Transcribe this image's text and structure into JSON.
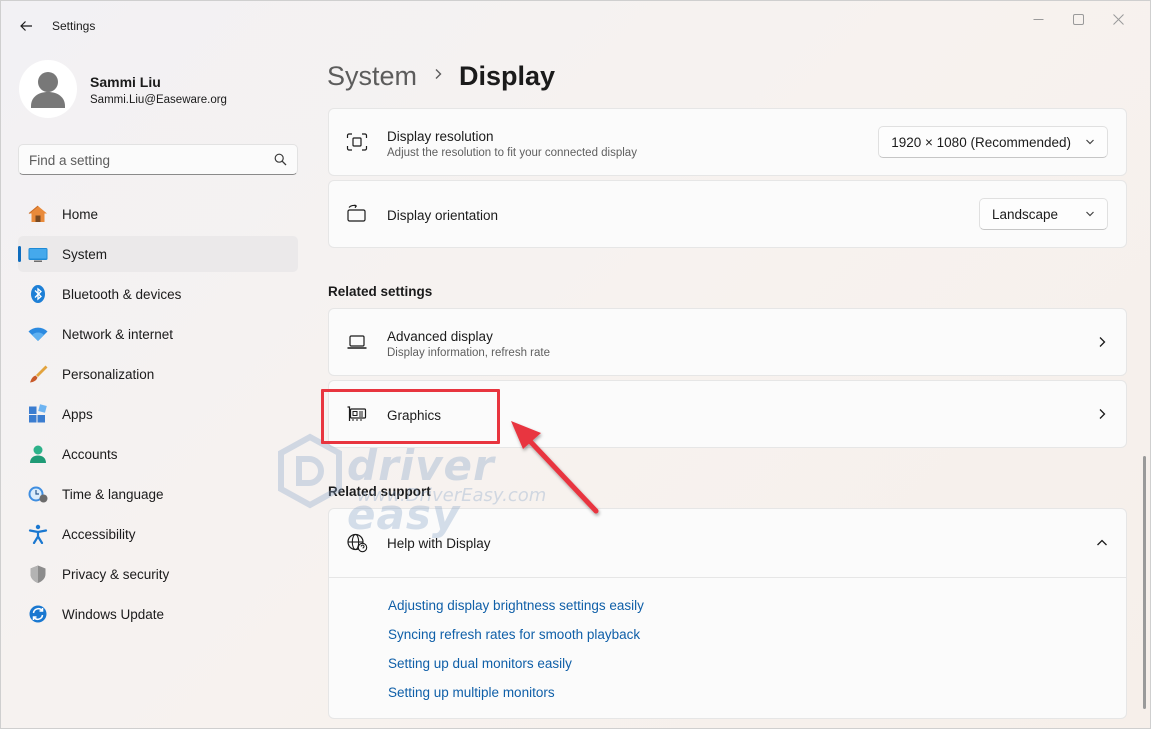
{
  "app": {
    "title": "Settings"
  },
  "profile": {
    "name": "Sammi Liu",
    "email": "Sammi.Liu@Easeware.org"
  },
  "search": {
    "placeholder": "Find a setting"
  },
  "nav": {
    "items": [
      {
        "label": "Home",
        "icon": "home-icon"
      },
      {
        "label": "System",
        "icon": "system-icon",
        "active": true
      },
      {
        "label": "Bluetooth & devices",
        "icon": "bluetooth-icon"
      },
      {
        "label": "Network & internet",
        "icon": "wifi-icon"
      },
      {
        "label": "Personalization",
        "icon": "brush-icon"
      },
      {
        "label": "Apps",
        "icon": "apps-icon"
      },
      {
        "label": "Accounts",
        "icon": "accounts-icon"
      },
      {
        "label": "Time & language",
        "icon": "time-language-icon"
      },
      {
        "label": "Accessibility",
        "icon": "accessibility-icon"
      },
      {
        "label": "Privacy & security",
        "icon": "shield-icon"
      },
      {
        "label": "Windows Update",
        "icon": "windows-update-icon"
      }
    ]
  },
  "breadcrumb": {
    "parent": "System",
    "current": "Display"
  },
  "display_settings": {
    "resolution": {
      "title": "Display resolution",
      "subtitle": "Adjust the resolution to fit your connected display",
      "value": "1920 × 1080 (Recommended)"
    },
    "orientation": {
      "title": "Display orientation",
      "value": "Landscape"
    }
  },
  "related_settings": {
    "heading": "Related settings",
    "advanced": {
      "title": "Advanced display",
      "subtitle": "Display information, refresh rate"
    },
    "graphics": {
      "title": "Graphics"
    }
  },
  "related_support": {
    "heading": "Related support",
    "help": {
      "title": "Help with Display",
      "links": [
        "Adjusting display brightness settings easily",
        "Syncing refresh rates for smooth playback",
        "Setting up dual monitors easily",
        "Setting up multiple monitors"
      ]
    }
  },
  "watermark": {
    "text": "driver easy",
    "url": "www.DriverEasy.com"
  },
  "colors": {
    "accent": "#0f6cbd",
    "link": "#0f5fa8",
    "annotation": "#e8353f"
  }
}
